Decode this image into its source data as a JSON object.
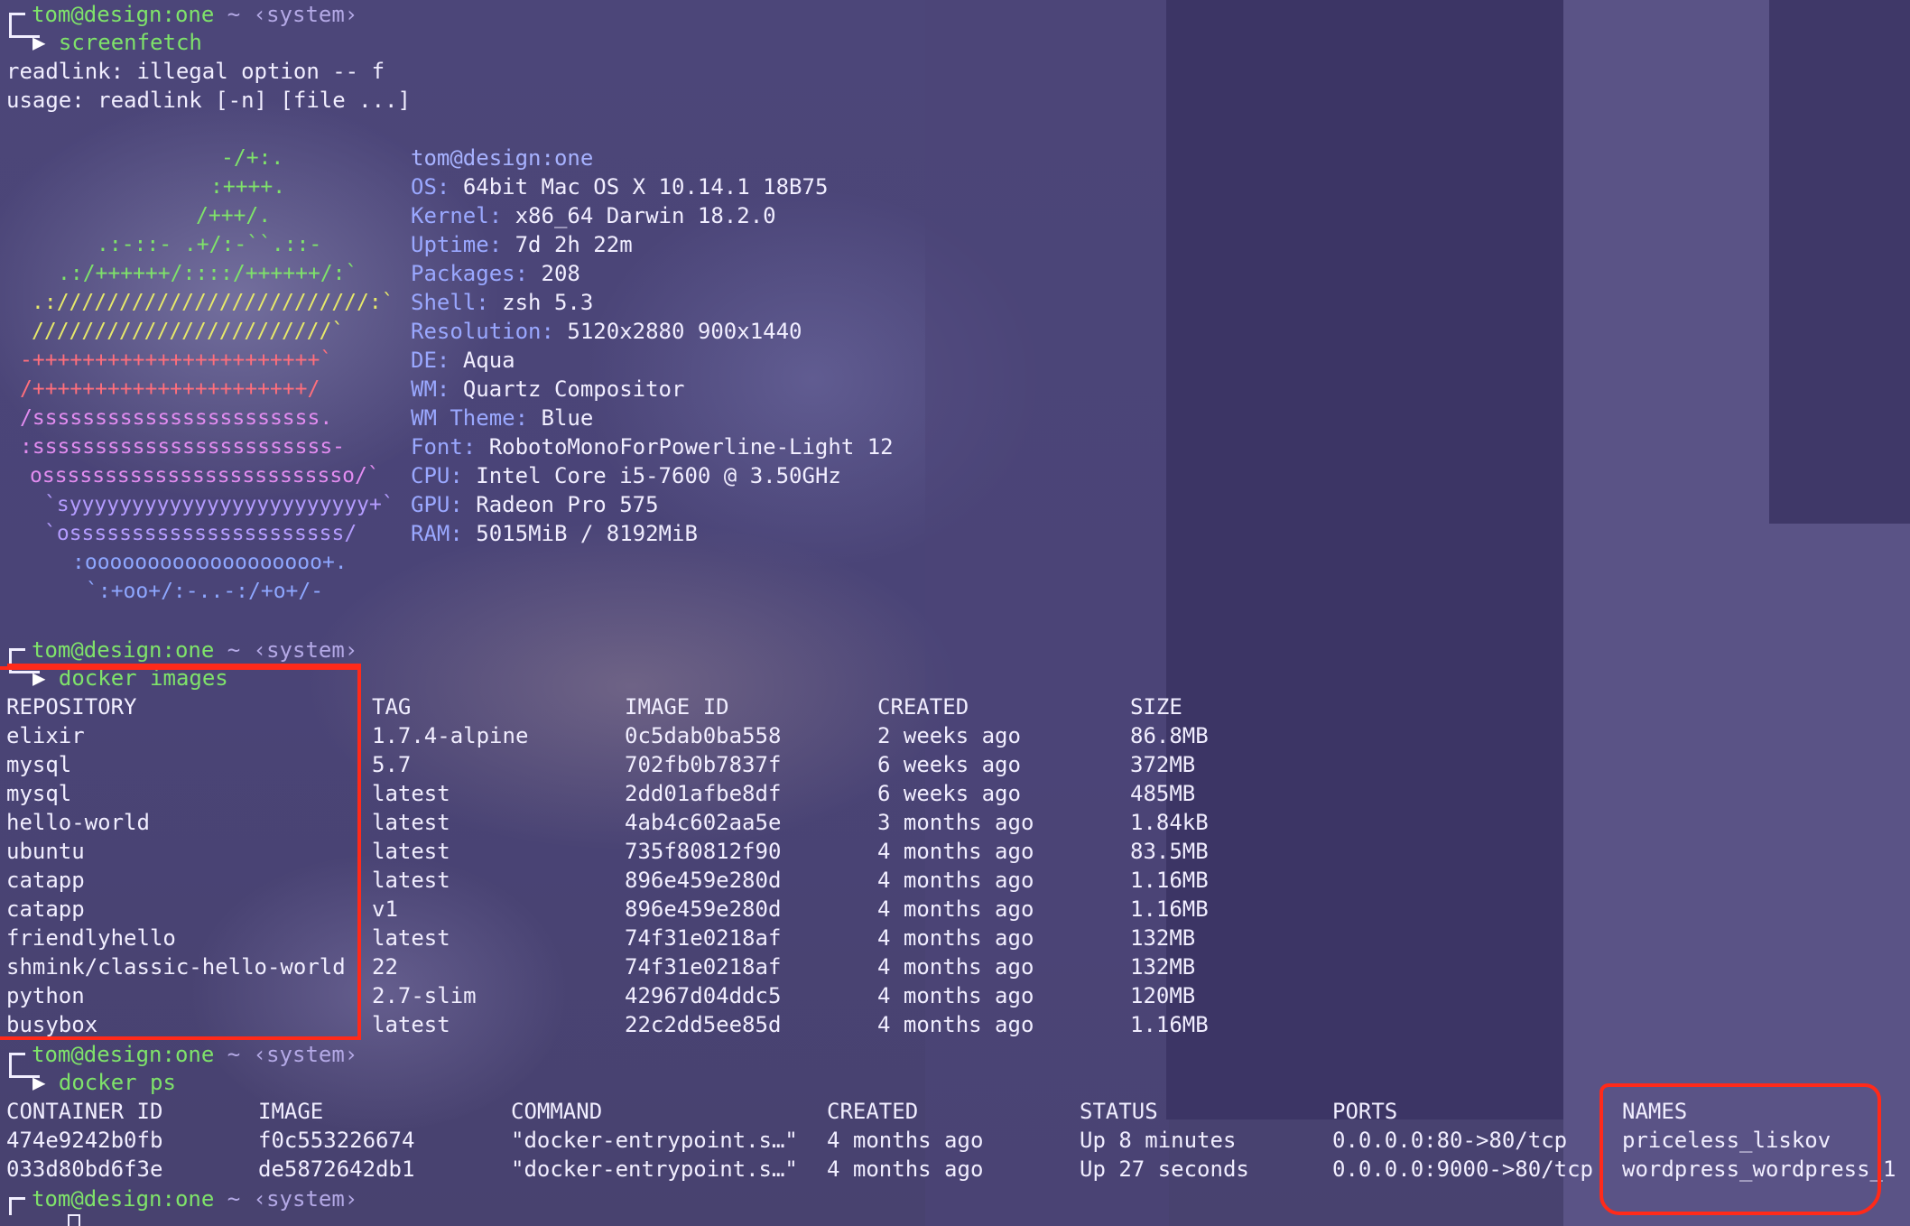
{
  "prompt": {
    "user_host": "tom@design:one",
    "path": "~",
    "context": "‹system›"
  },
  "session": [
    {
      "command": "screenfetch"
    },
    {
      "command": "docker images"
    },
    {
      "command": "docker ps"
    }
  ],
  "readlink_errors": [
    "readlink: illegal option -- f",
    "usage: readlink [-n] [file ...]"
  ],
  "screenfetch": {
    "user_host": "tom@design:one",
    "logo_lines": [
      {
        "text": "-/+:.",
        "color": "#7fe36a"
      },
      {
        "text": ":++++.",
        "color": "#7fe36a"
      },
      {
        "text": "/+++/.",
        "color": "#7fe36a"
      },
      {
        "text": ".:-::- .+/:-``.::-",
        "color": "#7fe36a"
      },
      {
        "text": ".:/++++++/::::/++++++/:`",
        "color": "#7fe36a"
      },
      {
        "text": ".://///////////////////////:`",
        "color": "#e7e96a"
      },
      {
        "text": "////////////////////////`",
        "color": "#e7e96a"
      },
      {
        "text": "-+++++++++++++++++++++++`",
        "color": "#ff6f7c"
      },
      {
        "text": "/++++++++++++++++++++++/",
        "color": "#ff6f7c"
      },
      {
        "text": "/sssssssssssssssssssssss.",
        "color": "#e28cf0"
      },
      {
        "text": ":ssssssssssssssssssssssss-",
        "color": "#e28cf0"
      },
      {
        "text": "osssssssssssssssssssssssso/`",
        "color": "#e28cf0"
      },
      {
        "text": "`syyyyyyyyyyyyyyyyyyyyyyyy+`",
        "color": "#b49cff"
      },
      {
        "text": "`ossssssssssssssssssssss/",
        "color": "#b49cff"
      },
      {
        "text": ":ooooooooooooooooooo+.",
        "color": "#8ea7ff"
      },
      {
        "text": "`:+oo+/:-..-:/+o+/-",
        "color": "#8ea7ff"
      }
    ],
    "info": [
      {
        "key": "OS",
        "value": "64bit Mac OS X 10.14.1 18B75"
      },
      {
        "key": "Kernel",
        "value": "x86_64 Darwin 18.2.0"
      },
      {
        "key": "Uptime",
        "value": "7d 2h 22m"
      },
      {
        "key": "Packages",
        "value": "208"
      },
      {
        "key": "Shell",
        "value": "zsh 5.3"
      },
      {
        "key": "Resolution",
        "value": "5120x2880 900x1440"
      },
      {
        "key": "DE",
        "value": "Aqua"
      },
      {
        "key": "WM",
        "value": "Quartz Compositor"
      },
      {
        "key": "WM Theme",
        "value": "Blue"
      },
      {
        "key": "Font",
        "value": "RobotoMonoForPowerline-Light 12"
      },
      {
        "key": "CPU",
        "value": "Intel Core i5-7600 @ 3.50GHz"
      },
      {
        "key": "GPU",
        "value": "Radeon Pro 575"
      },
      {
        "key": "RAM",
        "value": "5015MiB / 8192MiB"
      }
    ]
  },
  "docker_images": {
    "headers": [
      "REPOSITORY",
      "TAG",
      "IMAGE ID",
      "CREATED",
      "SIZE"
    ],
    "rows": [
      [
        "elixir",
        "1.7.4-alpine",
        "0c5dab0ba558",
        "2 weeks ago",
        "86.8MB"
      ],
      [
        "mysql",
        "5.7",
        "702fb0b7837f",
        "6 weeks ago",
        "372MB"
      ],
      [
        "mysql",
        "latest",
        "2dd01afbe8df",
        "6 weeks ago",
        "485MB"
      ],
      [
        "hello-world",
        "latest",
        "4ab4c602aa5e",
        "3 months ago",
        "1.84kB"
      ],
      [
        "ubuntu",
        "latest",
        "735f80812f90",
        "4 months ago",
        "83.5MB"
      ],
      [
        "catapp",
        "latest",
        "896e459e280d",
        "4 months ago",
        "1.16MB"
      ],
      [
        "catapp",
        "v1",
        "896e459e280d",
        "4 months ago",
        "1.16MB"
      ],
      [
        "friendlyhello",
        "latest",
        "74f31e0218af",
        "4 months ago",
        "132MB"
      ],
      [
        "shmink/classic-hello-world",
        "22",
        "74f31e0218af",
        "4 months ago",
        "132MB"
      ],
      [
        "python",
        "2.7-slim",
        "42967d04ddc5",
        "4 months ago",
        "120MB"
      ],
      [
        "busybox",
        "latest",
        "22c2dd5ee85d",
        "4 months ago",
        "1.16MB"
      ]
    ]
  },
  "docker_ps": {
    "headers": [
      "CONTAINER ID",
      "IMAGE",
      "COMMAND",
      "CREATED",
      "STATUS",
      "PORTS",
      "NAMES"
    ],
    "rows": [
      [
        "474e9242b0fb",
        "f0c553226674",
        "\"docker-entrypoint.s…\"",
        "4 months ago",
        "Up 8 minutes",
        "0.0.0.0:80->80/tcp",
        "priceless_liskov"
      ],
      [
        "033d80bd6f3e",
        "de5872642db1",
        "\"docker-entrypoint.s…\"",
        "4 months ago",
        "Up 27 seconds",
        "0.0.0.0:9000->80/tcp",
        "wordpress_wordpress_1"
      ]
    ]
  },
  "colors": {
    "prompt_green": "#7fe36a",
    "annotation_red": "#ff2a1a",
    "background": "#4a4477"
  }
}
